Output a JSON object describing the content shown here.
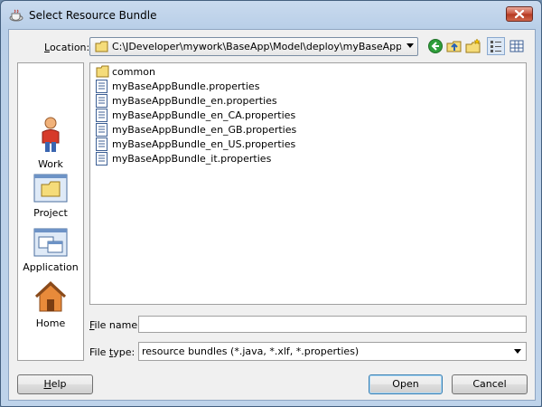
{
  "window": {
    "title": "Select Resource Bundle"
  },
  "location": {
    "label_first": "L",
    "label_rest": "ocation:",
    "path": "C:\\JDeveloper\\mywork\\BaseApp\\Model\\deploy\\myBaseApp.jar!\\..."
  },
  "toolbar": {
    "icons": [
      "back-icon",
      "up-folder-icon",
      "new-folder-icon",
      "list-view-icon",
      "details-view-icon"
    ]
  },
  "places": [
    {
      "label": "Work",
      "icon": "work-person-icon"
    },
    {
      "label": "Project",
      "icon": "project-folder-icon"
    },
    {
      "label": "Application",
      "icon": "application-window-icon"
    },
    {
      "label": "Home",
      "icon": "home-icon"
    }
  ],
  "files": [
    {
      "name": "common",
      "type": "folder"
    },
    {
      "name": "myBaseAppBundle.properties",
      "type": "file"
    },
    {
      "name": "myBaseAppBundle_en.properties",
      "type": "file"
    },
    {
      "name": "myBaseAppBundle_en_CA.properties",
      "type": "file"
    },
    {
      "name": "myBaseAppBundle_en_GB.properties",
      "type": "file"
    },
    {
      "name": "myBaseAppBundle_en_US.properties",
      "type": "file"
    },
    {
      "name": "myBaseAppBundle_it.properties",
      "type": "file"
    }
  ],
  "file_name": {
    "label_first": "F",
    "label_rest": "ile name:",
    "value": ""
  },
  "file_type": {
    "label_first": "",
    "label_mid": "File ",
    "label_u": "t",
    "label_rest": "ype:",
    "value": "resource bundles (*.java, *.xlf, *.properties)"
  },
  "buttons": {
    "help_u": "H",
    "help_rest": "elp",
    "open": "Open",
    "cancel": "Cancel"
  }
}
